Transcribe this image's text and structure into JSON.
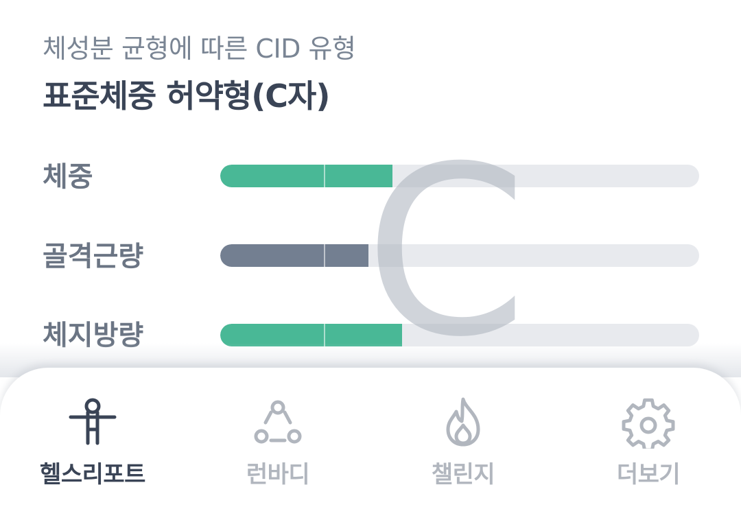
{
  "header": {
    "subtitle": "체성분 균형에 따른 CID 유형",
    "type_title": "표준체중 허약형(C자)"
  },
  "grade": {
    "letter": "C"
  },
  "metrics": [
    {
      "label": "체중",
      "level": 0.36,
      "color": "#49b896"
    },
    {
      "label": "골격근량",
      "level": 0.31,
      "color": "#737f91"
    },
    {
      "label": "체지방량",
      "level": 0.38,
      "color": "#49b896"
    }
  ],
  "colors": {
    "accent_green": "#49b896",
    "muscle_slate": "#737f91",
    "track": "#e8eaee",
    "active_text": "#3a4456",
    "inactive_text": "#b1b6be"
  },
  "bottom_nav": {
    "items": [
      {
        "label": "헬스리포트",
        "icon": "person-icon",
        "active": true
      },
      {
        "label": "런바디",
        "icon": "network-icon",
        "active": false
      },
      {
        "label": "챌린지",
        "icon": "flame-icon",
        "active": false
      },
      {
        "label": "더보기",
        "icon": "gear-icon",
        "active": false
      }
    ]
  }
}
